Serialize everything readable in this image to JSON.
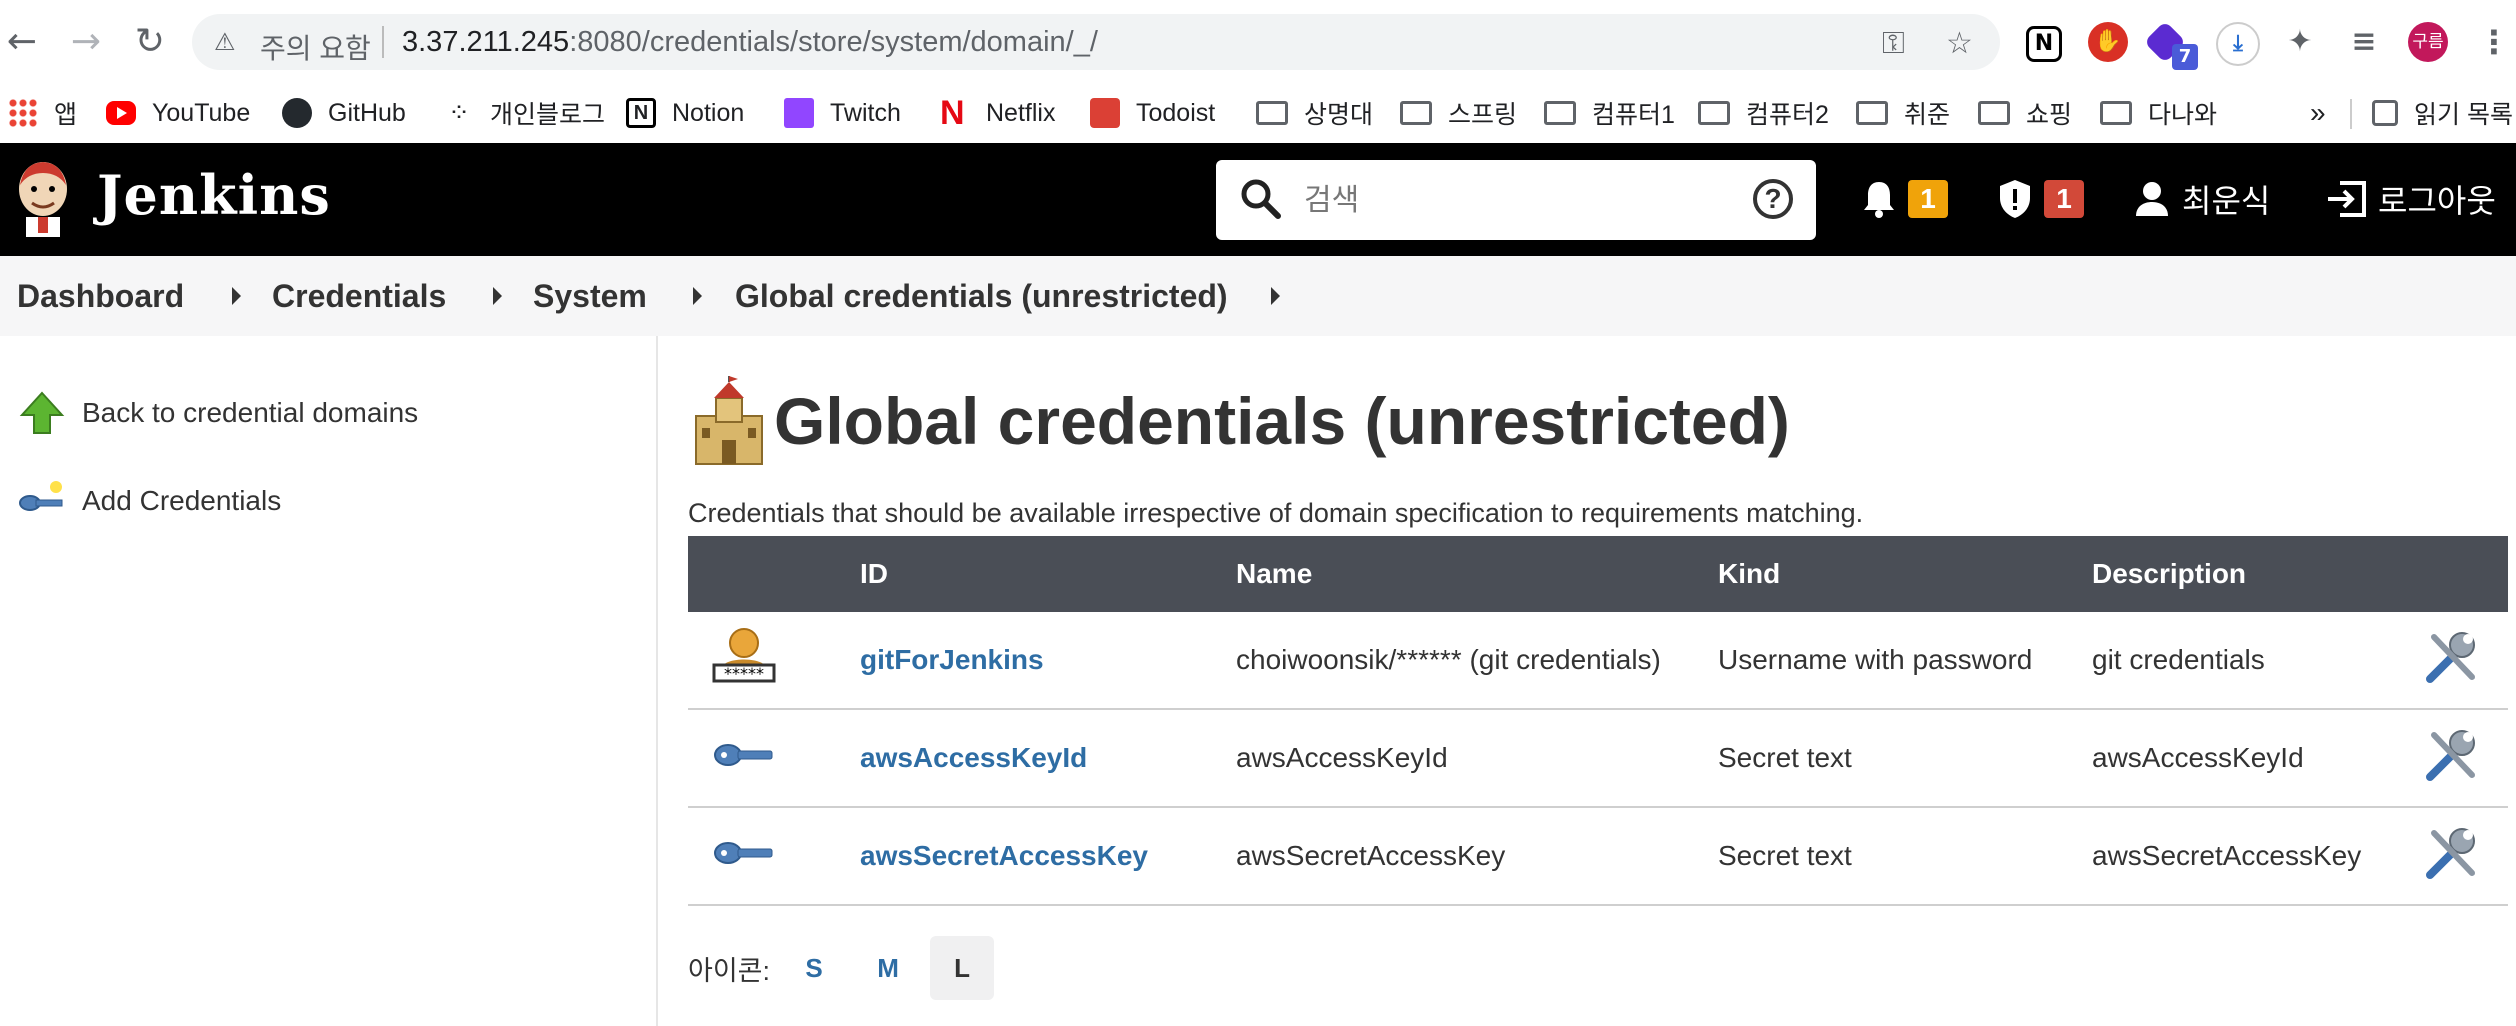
{
  "browser": {
    "security_label": "주의 요함",
    "url_host": "3.37.211.245",
    "url_rest": ":8080/credentials/store/system/domain/_/",
    "profile_initials": "구름",
    "ext_badge": "7",
    "bookmarks": [
      {
        "label": "앱",
        "icon": "apps-grid-icon"
      },
      {
        "label": "YouTube",
        "icon": "youtube-icon"
      },
      {
        "label": "GitHub",
        "icon": "github-icon"
      },
      {
        "label": "개인블로그",
        "icon": "blog-icon"
      },
      {
        "label": "Notion",
        "icon": "notion-icon"
      },
      {
        "label": "Twitch",
        "icon": "twitch-icon"
      },
      {
        "label": "Netflix",
        "icon": "netflix-icon"
      },
      {
        "label": "Todoist",
        "icon": "todoist-icon"
      },
      {
        "label": "상명대",
        "icon": "folder-icon"
      },
      {
        "label": "스프링",
        "icon": "folder-icon"
      },
      {
        "label": "컴퓨터1",
        "icon": "folder-icon"
      },
      {
        "label": "컴퓨터2",
        "icon": "folder-icon"
      },
      {
        "label": "취준",
        "icon": "folder-icon"
      },
      {
        "label": "쇼핑",
        "icon": "folder-icon"
      },
      {
        "label": "다나와",
        "icon": "folder-icon"
      }
    ],
    "overflow": "»",
    "reading_list": "읽기 목록"
  },
  "header": {
    "title": "Jenkins",
    "search_placeholder": "검색",
    "notifications_count": "1",
    "security_count": "1",
    "user": "최운식",
    "logout": "로그아웃"
  },
  "breadcrumb": [
    "Dashboard",
    "Credentials",
    "System",
    "Global credentials (unrestricted)"
  ],
  "sidebar": {
    "back": "Back to credential domains",
    "add": "Add Credentials"
  },
  "main": {
    "title": "Global credentials (unrestricted)",
    "description": "Credentials that should be available irrespective of domain specification to requirements matching.",
    "columns": [
      "ID",
      "Name",
      "Kind",
      "Description"
    ],
    "rows": [
      {
        "icon": "user-password-icon",
        "id": "gitForJenkins",
        "name": "choiwoonsik/****** (git credentials)",
        "kind": "Username with password",
        "description": "git credentials"
      },
      {
        "icon": "key-icon",
        "id": "awsAccessKeyId",
        "name": "awsAccessKeyId",
        "kind": "Secret text",
        "description": "awsAccessKeyId"
      },
      {
        "icon": "key-icon",
        "id": "awsSecretAccessKey",
        "name": "awsSecretAccessKey",
        "kind": "Secret text",
        "description": "awsSecretAccessKey"
      }
    ],
    "icon_label": "아이콘:",
    "sizes": [
      "S",
      "M",
      "L"
    ],
    "active_size": "L"
  },
  "colors": {
    "header_bg": "#000000",
    "table_header_bg": "#4a4e56",
    "link": "#2e6da4",
    "notif_badge": "#f0a30a",
    "security_badge": "#d24939"
  }
}
